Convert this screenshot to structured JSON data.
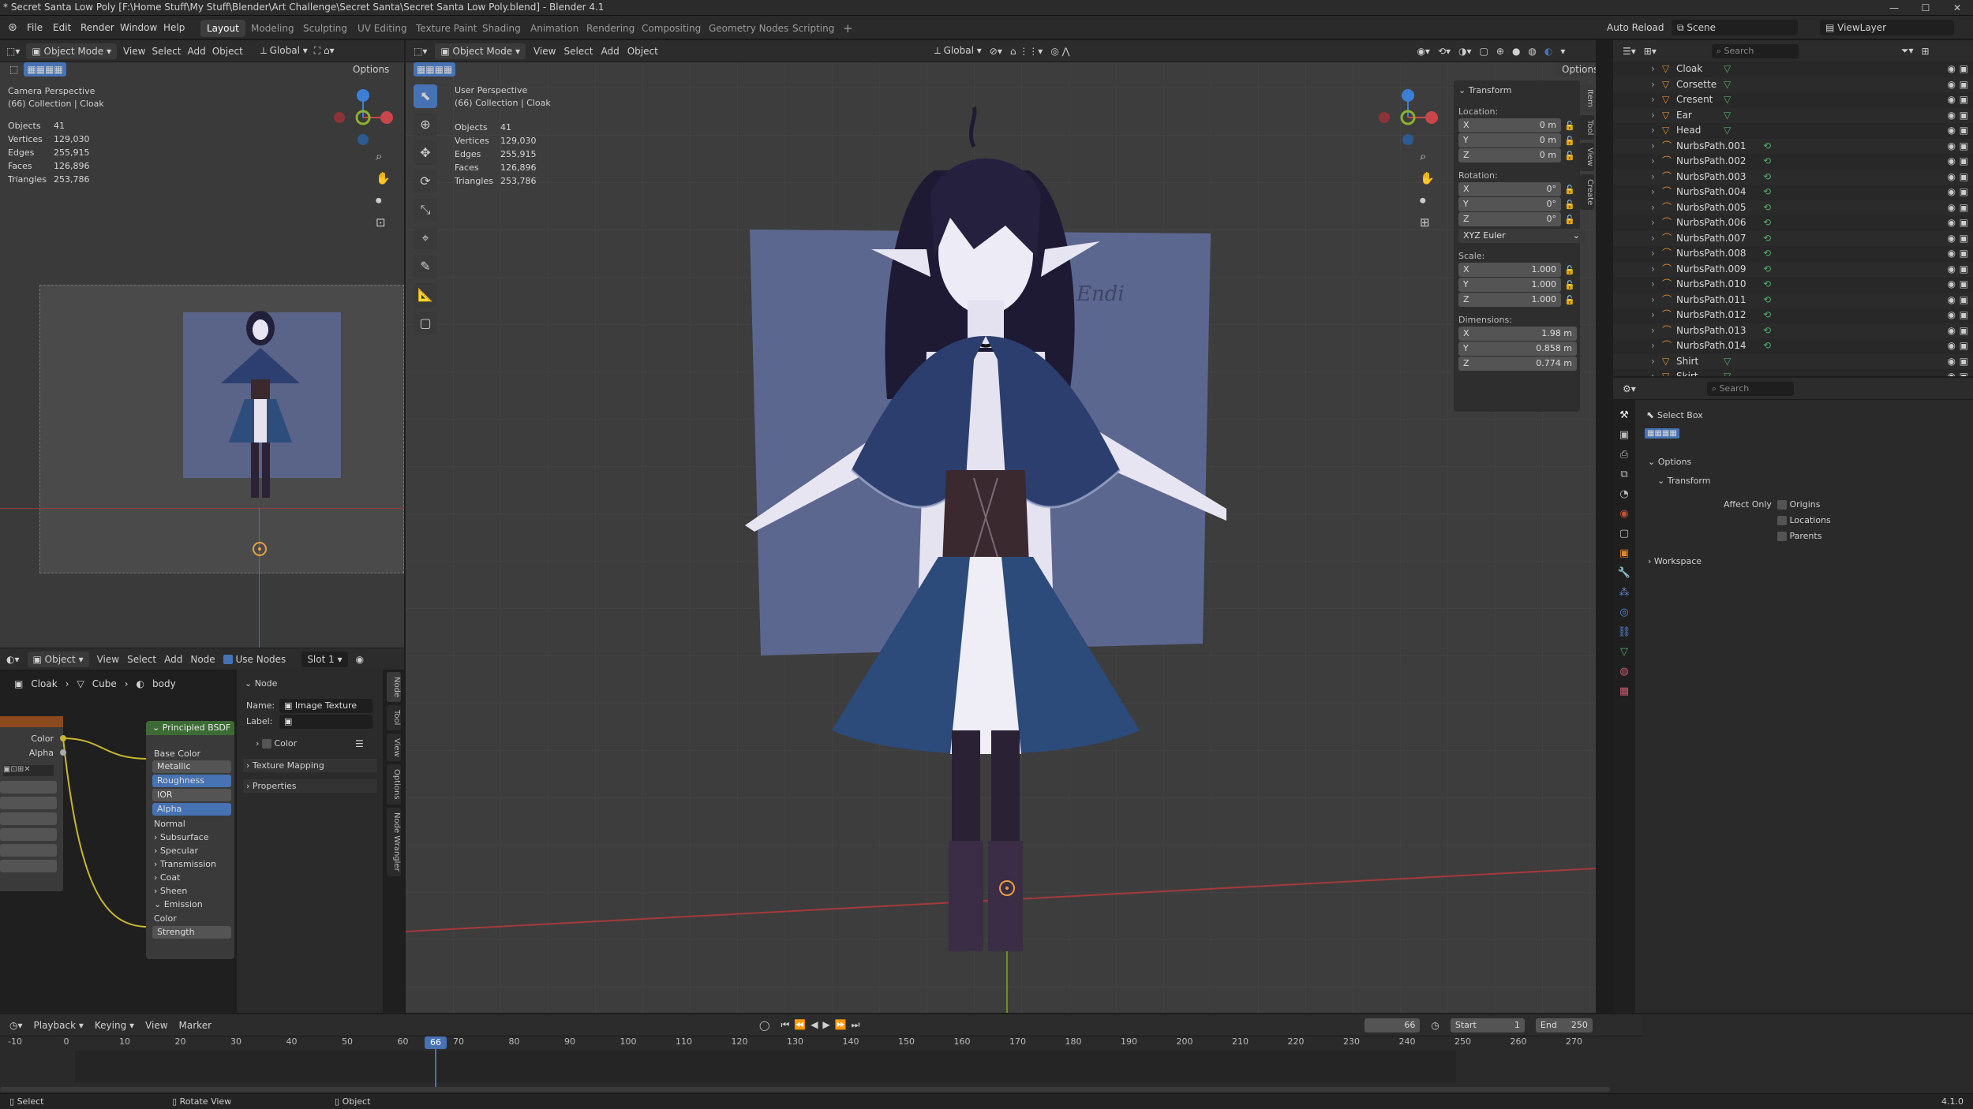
{
  "window": {
    "title": "* Secret Santa Low Poly [F:\\Home Stuff\\My Stuff\\Blender\\Art Challenge\\Secret Santa\\Secret Santa Low Poly.blend] - Blender 4.1",
    "minimize": "—",
    "maximize": "☐",
    "close": "✕"
  },
  "menubar": {
    "items": [
      "File",
      "Edit",
      "Render",
      "Window",
      "Help"
    ]
  },
  "workspaces": [
    "Layout",
    "Modeling",
    "Sculpting",
    "UV Editing",
    "Texture Paint",
    "Shading",
    "Animation",
    "Rendering",
    "Compositing",
    "Geometry Nodes",
    "Scripting"
  ],
  "workspace_add": "+",
  "topright": {
    "auto_reload": "Auto Reload",
    "scene": "Scene",
    "view_layer": "ViewLayer"
  },
  "left_viewport": {
    "mode": "Object Mode",
    "menus": [
      "View",
      "Select",
      "Add",
      "Object"
    ],
    "orientation": "Global",
    "options": "Options",
    "title": "Camera Perspective",
    "collection": "(66) Collection | Cloak",
    "stats": [
      [
        "Objects",
        "41"
      ],
      [
        "Vertices",
        "129,030"
      ],
      [
        "Edges",
        "255,915"
      ],
      [
        "Faces",
        "126,896"
      ],
      [
        "Triangles",
        "253,786"
      ]
    ]
  },
  "main_viewport": {
    "mode": "Object Mode",
    "menus": [
      "View",
      "Select",
      "Add",
      "Object"
    ],
    "orientation": "Global",
    "options": "Options",
    "title": "User Perspective",
    "collection": "(66) Collection | Cloak",
    "stats": [
      [
        "Objects",
        "41"
      ],
      [
        "Vertices",
        "129,030"
      ],
      [
        "Edges",
        "255,915"
      ],
      [
        "Faces",
        "126,896"
      ],
      [
        "Triangles",
        "253,786"
      ]
    ],
    "tabs": [
      "Item",
      "Tool",
      "View",
      "Create"
    ]
  },
  "transform_panel": {
    "title": "Transform",
    "location_label": "Location:",
    "location": [
      [
        "X",
        "0 m"
      ],
      [
        "Y",
        "0 m"
      ],
      [
        "Z",
        "0 m"
      ]
    ],
    "rotation_label": "Rotation:",
    "rotation": [
      [
        "X",
        "0°"
      ],
      [
        "Y",
        "0°"
      ],
      [
        "Z",
        "0°"
      ]
    ],
    "rotation_mode": "XYZ Euler",
    "scale_label": "Scale:",
    "scale": [
      [
        "X",
        "1.000"
      ],
      [
        "Y",
        "1.000"
      ],
      [
        "Z",
        "1.000"
      ]
    ],
    "dimensions_label": "Dimensions:",
    "dimensions": [
      [
        "X",
        "1.98 m"
      ],
      [
        "Y",
        "0.858 m"
      ],
      [
        "Z",
        "0.774 m"
      ]
    ]
  },
  "outliner": {
    "search_placeholder": "Search",
    "items": [
      "Cloak",
      "Corsette",
      "Cresent",
      "Ear",
      "Head",
      "NurbsPath.001",
      "NurbsPath.002",
      "NurbsPath.003",
      "NurbsPath.004",
      "NurbsPath.005",
      "NurbsPath.006",
      "NurbsPath.007",
      "NurbsPath.008",
      "NurbsPath.009",
      "NurbsPath.010",
      "NurbsPath.011",
      "NurbsPath.012",
      "NurbsPath.013",
      "NurbsPath.014",
      "Shirt",
      "Skirt"
    ]
  },
  "properties": {
    "search_placeholder": "Search",
    "tool": "Select Box",
    "options": "Options",
    "transform": "Transform",
    "affect_only": "Affect Only",
    "checks": [
      "Origins",
      "Locations",
      "Parents"
    ],
    "workspace": "Workspace"
  },
  "node_editor": {
    "object": "Object",
    "menus": [
      "View",
      "Select",
      "Add",
      "Node"
    ],
    "use_nodes": "Use Nodes",
    "slot": "Slot 1",
    "breadcrumb": [
      "Cloak",
      "Cube",
      "body"
    ],
    "tex_outputs": [
      "Color",
      "Alpha"
    ],
    "bsdf": {
      "title": "Principled BSDF",
      "sockets": [
        "Base Color",
        "Metallic",
        "Roughness",
        "IOR",
        "Alpha",
        "Normal",
        "Subsurface",
        "Specular",
        "Transmission",
        "Coat",
        "Sheen",
        "Emission",
        "Color",
        "Strength"
      ]
    },
    "sidebar": {
      "node": "Node",
      "name_label": "Name:",
      "name_value": "Image Texture",
      "label_label": "Label:",
      "color": "Color",
      "texture_mapping": "Texture Mapping",
      "properties": "Properties"
    },
    "tabs": [
      "Node",
      "Tool",
      "View",
      "Options",
      "Node Wrangler"
    ]
  },
  "timeline": {
    "menus": [
      "Playback",
      "Keying",
      "View",
      "Marker"
    ],
    "current": "66",
    "start_label": "Start",
    "start": "1",
    "end_label": "End",
    "end": "250",
    "ticks": [
      "-10",
      "0",
      "10",
      "20",
      "30",
      "40",
      "50",
      "60",
      "70",
      "80",
      "90",
      "100",
      "110",
      "120",
      "130",
      "140",
      "150",
      "160",
      "170",
      "180",
      "190",
      "200",
      "210",
      "220",
      "230",
      "240",
      "250",
      "260",
      "270"
    ]
  },
  "statusbar": {
    "select": "Select",
    "rotate": "Rotate View",
    "object": "Object",
    "version": "4.1.0"
  },
  "colors": {
    "accent": "#4772b3",
    "bg": "#1d1d1d",
    "header": "#2c2c2c",
    "viewport": "#3d3d3d",
    "x_axis": "#c8464b",
    "y_axis": "#8bb22f",
    "z_axis": "#3d7fd6"
  }
}
